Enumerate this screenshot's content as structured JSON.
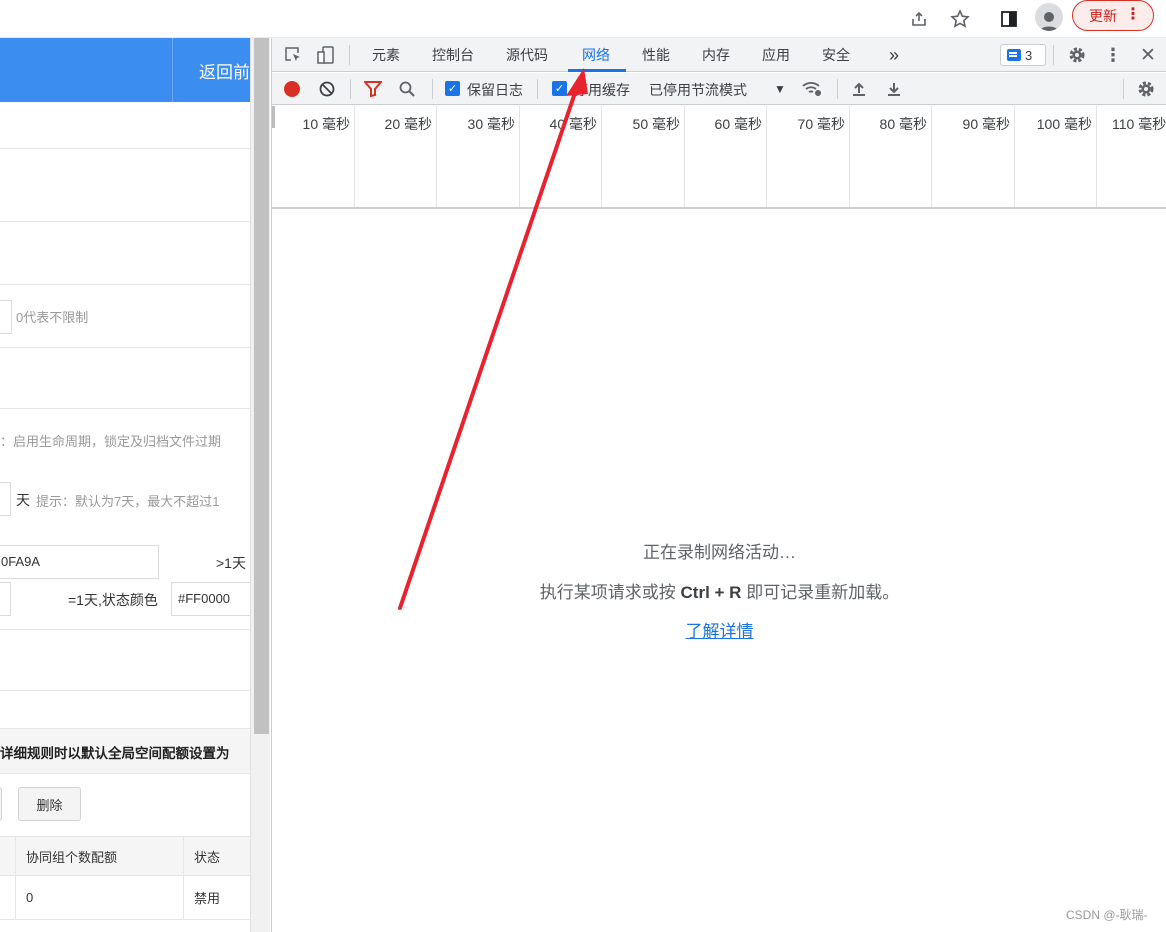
{
  "browser": {
    "update_label": "更新"
  },
  "page": {
    "header_back": "返回前",
    "hint_unlimited": "0代表不限制",
    "hint_lifecycle": "：启用生命周期，锁定及归档文件过期",
    "unit_day": "天",
    "hint_default": "提示：默认为7天，最大不超过1",
    "color1_value": "0FA9A",
    "gt1_label": ">1天",
    "eq1_label": "=1天,状态颜色",
    "color2_value": "#FF0000",
    "section_title": "详细规则时以默认全局空间配额设置为",
    "delete_button": "删除",
    "table": {
      "headers": [
        "协同组个数配额",
        "状态"
      ],
      "rows": [
        [
          "0",
          "禁用"
        ]
      ]
    }
  },
  "devtools": {
    "tabs": [
      "元素",
      "控制台",
      "源代码",
      "网络",
      "性能",
      "内存",
      "应用",
      "安全"
    ],
    "active_tab": "网络",
    "more_tabs": "»",
    "issues_count": "3",
    "preserve_log": "保留日志",
    "disable_cache": "停用缓存",
    "throttle": "已停用节流模式",
    "timeline_ticks": [
      "10 毫秒",
      "20 毫秒",
      "30 毫秒",
      "40 毫秒",
      "50 毫秒",
      "60 毫秒",
      "70 毫秒",
      "80 毫秒",
      "90 毫秒",
      "100 毫秒",
      "110 毫秒"
    ],
    "recording_line1": "正在录制网络活动…",
    "recording_line2_pre": "执行某项请求或按",
    "recording_line2_keys": "Ctrl + R",
    "recording_line2_post": "即可记录重新加载。",
    "learn_more": "了解详情"
  },
  "watermark": "CSDN @-耿瑞-",
  "colors": {
    "accent": "#1a73e8",
    "record": "#d93025",
    "arrow": "#e8232f",
    "header_blue": "#3c8df0"
  }
}
